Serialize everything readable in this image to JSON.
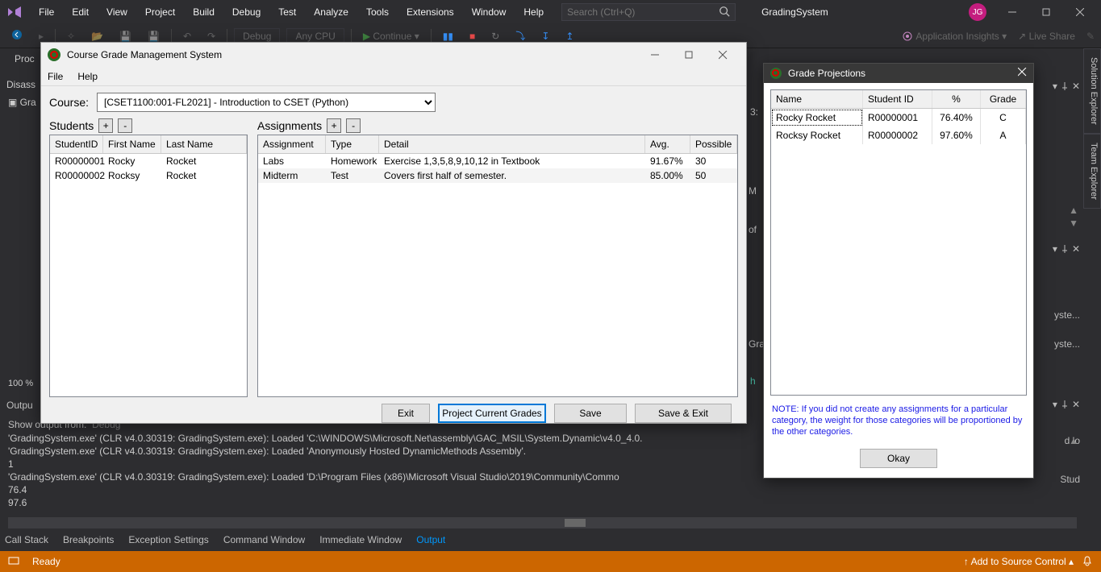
{
  "menubar": {
    "items": [
      "File",
      "Edit",
      "View",
      "Project",
      "Build",
      "Debug",
      "Test",
      "Analyze",
      "Tools",
      "Extensions",
      "Window",
      "Help"
    ],
    "search_placeholder": "Search (Ctrl+Q)",
    "project": "GradingSystem",
    "avatar": "JG"
  },
  "toolbar": {
    "config": "Debug",
    "platform": "Any CPU",
    "continue": "Continue",
    "insights": "Application Insights",
    "liveshare": "Live Share"
  },
  "leftpanel": {
    "disass": "Disass",
    "gra": "Gra",
    "proc": "Proc",
    "zoom": "100 %"
  },
  "output": {
    "tab": "Outpu",
    "showfrom_label": "Show output from:",
    "showfrom_value": "Debug",
    "lines": [
      "'GradingSystem.exe' (CLR v4.0.30319: GradingSystem.exe): Loaded 'C:\\WINDOWS\\Microsoft.Net\\assembly\\GAC_MSIL\\System.Dynamic\\v4.0_4.0.",
      "'GradingSystem.exe' (CLR v4.0.30319: GradingSystem.exe): Loaded 'Anonymously Hosted DynamicMethods Assembly'.",
      "1",
      "'GradingSystem.exe' (CLR v4.0.30319: GradingSystem.exe): Loaded 'D:\\Program Files (x86)\\Microsoft Visual Studio\\2019\\Community\\Commo",
      "76.4",
      "97.6"
    ],
    "right_frag1": "d lo",
    "right_frag2": "Stud"
  },
  "bottomtabs": [
    "Call Stack",
    "Breakpoints",
    "Exception Settings",
    "Command Window",
    "Immediate Window",
    "Output"
  ],
  "status": {
    "ready": "Ready",
    "source": "Add to Source Control"
  },
  "sidetabs": [
    "Solution Explorer",
    "Team Explorer"
  ],
  "hidden": {
    "m": "M",
    "of": "of",
    "h": "h",
    "three": "3:",
    "syste1": "yste...",
    "syste2": "yste...",
    "gra": "Gra"
  },
  "win1": {
    "title": "Course Grade Management System",
    "menu": [
      "File",
      "Help"
    ],
    "course_label": "Course:",
    "course_value": "[CSET1100:001-FL2021] - Introduction to CSET (Python)",
    "students_label": "Students",
    "assignments_label": "Assignments",
    "add": "+",
    "minus": "-",
    "students": {
      "cols": [
        "StudentID",
        "First Name",
        "Last Name"
      ],
      "rows": [
        {
          "id": "R00000001",
          "fn": "Rocky",
          "ln": "Rocket"
        },
        {
          "id": "R00000002",
          "fn": "Rocksy",
          "ln": "Rocket"
        }
      ]
    },
    "assignments": {
      "cols": [
        "Assignment",
        "Type",
        "Detail",
        "Avg.",
        "Possible"
      ],
      "rows": [
        {
          "as": "Labs",
          "ty": "Homework",
          "de": "Exercise 1,3,5,8,9,10,12 in Textbook",
          "av": "91.67%",
          "po": "30"
        },
        {
          "as": "Midterm",
          "ty": "Test",
          "de": "Covers first half of semester.",
          "av": "85.00%",
          "po": "50"
        }
      ]
    },
    "buttons": {
      "exit": "Exit",
      "project": "Project Current Grades",
      "save": "Save",
      "saveexit": "Save & Exit"
    }
  },
  "win2": {
    "title": "Grade Projections",
    "cols": [
      "Name",
      "Student ID",
      "%",
      "Grade"
    ],
    "rows": [
      {
        "nm": "Rocky Rocket",
        "id": "R00000001",
        "pc": "76.40%",
        "gr": "C"
      },
      {
        "nm": "Rocksy Rocket",
        "id": "R00000002",
        "pc": "97.60%",
        "gr": "A"
      }
    ],
    "note": "NOTE: If you did not create any assignments for a particular category, the weight for those categories will be proportioned by the other categories.",
    "ok": "Okay"
  }
}
